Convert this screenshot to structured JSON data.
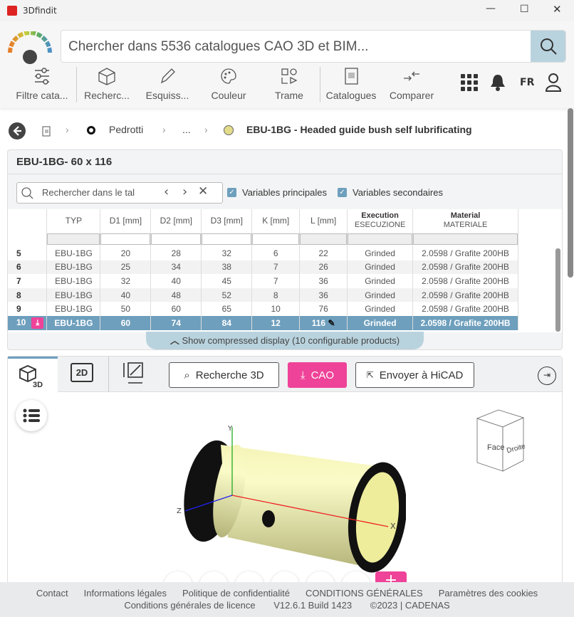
{
  "window": {
    "title": "3Dfindit"
  },
  "search": {
    "placeholder": "Chercher dans 5536 catalogues CAO 3D et BIM..."
  },
  "toolbar": {
    "items": [
      "Filtre cata...",
      "Recherc...",
      "Esquiss...",
      "Couleur",
      "Trame",
      "Catalogues",
      "Comparer"
    ],
    "language": "FR"
  },
  "breadcrumb": {
    "vendor": "Pedrotti",
    "ellipsis": "...",
    "product": "EBU-1BG - Headed guide bush self lubrificating"
  },
  "panel": {
    "title": "EBU-1BG- 60 x 116",
    "search_placeholder": "Rechercher dans le tal",
    "var_main": "Variables principales",
    "var_secondary": "Variables secondaires"
  },
  "table": {
    "headers": [
      "TYP",
      "D1 [mm]",
      "D2 [mm]",
      "D3 [mm]",
      "K [mm]",
      "L [mm]"
    ],
    "exec_header": "Execution",
    "exec_sub": "ESECUZIONE",
    "mat_header": "Material",
    "mat_sub": "MATERIALE",
    "rows": [
      [
        "5",
        "EBU-1BG",
        "20",
        "28",
        "32",
        "6",
        "22",
        "Grinded",
        "2.0598 / Grafite 200HB"
      ],
      [
        "6",
        "EBU-1BG",
        "25",
        "34",
        "38",
        "7",
        "26",
        "Grinded",
        "2.0598 / Grafite 200HB"
      ],
      [
        "7",
        "EBU-1BG",
        "32",
        "40",
        "45",
        "7",
        "36",
        "Grinded",
        "2.0598 / Grafite 200HB"
      ],
      [
        "8",
        "EBU-1BG",
        "40",
        "48",
        "52",
        "8",
        "36",
        "Grinded",
        "2.0598 / Grafite 200HB"
      ],
      [
        "9",
        "EBU-1BG",
        "50",
        "60",
        "65",
        "10",
        "76",
        "Grinded",
        "2.0598 / Grafite 200HB"
      ],
      [
        "10",
        "EBU-1BG",
        "60",
        "74",
        "84",
        "12",
        "116",
        "Grinded",
        "2.0598 / Grafite 200HB"
      ]
    ],
    "compressed": "Show compressed display (10 configurable products)"
  },
  "viewer": {
    "tab_3d": "3D",
    "tab_2d": "2D",
    "search3d": "Recherche 3D",
    "cad": "CAO",
    "send": "Envoyer à HiCAD",
    "cube_face": "Face",
    "cube_right": "Droite",
    "axes": [
      "X",
      "Y",
      "Z"
    ]
  },
  "footer": {
    "links": [
      "Contact",
      "Informations légales",
      "Politique de confidentialité",
      "CONDITIONS GÉNÉRALES",
      "Paramètres des cookies"
    ],
    "license": "Conditions générales de licence",
    "version": "V12.6.1 Build 1423",
    "copyright": "©2023 | CADENAS"
  },
  "colors": {
    "accent": "#ee4398",
    "selected_row": "#6e9fbd",
    "search_btn": "#b9d3de"
  }
}
